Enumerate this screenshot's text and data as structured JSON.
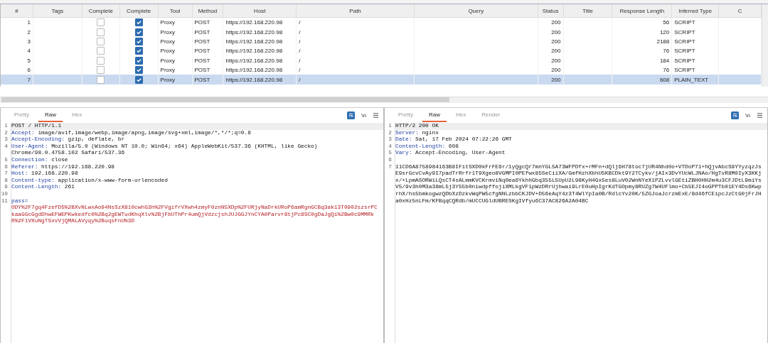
{
  "table": {
    "columns": [
      "#",
      "Tags",
      "Complete",
      "Complete",
      "Tool",
      "Method",
      "Host",
      "Path",
      "Query",
      "Status",
      "Title",
      "Response Length",
      "Inferred Type",
      "C"
    ],
    "rows": [
      {
        "num": "1",
        "complete_1": false,
        "complete_2": true,
        "tool": "Proxy",
        "method": "POST",
        "host": "https://192.168.220.98",
        "path": "/",
        "status": "200",
        "length": "56",
        "type": "SCRIPT",
        "selected": false
      },
      {
        "num": "2",
        "complete_1": false,
        "complete_2": true,
        "tool": "Proxy",
        "method": "POST",
        "host": "https://192.168.220.98",
        "path": "/",
        "status": "200",
        "length": "120",
        "type": "SCRIPT",
        "selected": false
      },
      {
        "num": "3",
        "complete_1": false,
        "complete_2": true,
        "tool": "Proxy",
        "method": "POST",
        "host": "https://192.168.220.98",
        "path": "/",
        "status": "200",
        "length": "2188",
        "type": "SCRIPT",
        "selected": false
      },
      {
        "num": "4",
        "complete_1": false,
        "complete_2": true,
        "tool": "Proxy",
        "method": "POST",
        "host": "https://192.168.220.98",
        "path": "/",
        "status": "200",
        "length": "76",
        "type": "SCRIPT",
        "selected": false
      },
      {
        "num": "5",
        "complete_1": false,
        "complete_2": true,
        "tool": "Proxy",
        "method": "POST",
        "host": "https://192.168.220.98",
        "path": "/",
        "status": "200",
        "length": "184",
        "type": "SCRIPT",
        "selected": false
      },
      {
        "num": "6",
        "complete_1": false,
        "complete_2": true,
        "tool": "Proxy",
        "method": "POST",
        "host": "https://192.168.220.98",
        "path": "/",
        "status": "200",
        "length": "76",
        "type": "SCRIPT",
        "selected": false
      },
      {
        "num": "7",
        "complete_1": false,
        "complete_2": true,
        "tool": "Proxy",
        "method": "POST",
        "host": "https://192.168.220.98",
        "path": "/",
        "status": "200",
        "length": "608",
        "type": "PLAIN_TEXT",
        "selected": true
      }
    ]
  },
  "panes": [
    {
      "tabs": [
        {
          "label": "Pretty",
          "selected": false
        },
        {
          "label": "Raw",
          "selected": true
        },
        {
          "label": "Hex",
          "selected": false
        }
      ],
      "newline_toggle": "\\n",
      "lines": [
        {
          "num": "1",
          "kind": "start",
          "text": "POST / HTTP/1.1"
        },
        {
          "num": "2",
          "kind": "header",
          "key": "Accept:",
          "text": "image/avif,image/webp,image/apng,image/svg+xml,image/*,*/*;q=0.8"
        },
        {
          "num": "3",
          "kind": "header",
          "key": "Accept-Encoding:",
          "text": "gzip, deflate, br"
        },
        {
          "num": "4",
          "kind": "header",
          "key": "User-Agent:",
          "text": "Mozilla/5.0 (Windows NT 10.0; Win64; x64) AppleWebKit/537.36 (KHTML, like Gecko) Chrome/98.0.4758.102 Safari/537.36"
        },
        {
          "num": "5",
          "kind": "header",
          "key": "Connection:",
          "text": "close"
        },
        {
          "num": "6",
          "kind": "header",
          "key": "Referer:",
          "text": "https://192.168.220.98"
        },
        {
          "num": "7",
          "kind": "header",
          "key": "Host:",
          "text": "192.168.220.98"
        },
        {
          "num": "8",
          "kind": "header",
          "key": "Content-type:",
          "text": "application/x-www-form-urlencoded"
        },
        {
          "num": "9",
          "kind": "header",
          "key": "Content-Length:",
          "text": "261"
        },
        {
          "num": "10",
          "kind": "blank"
        },
        {
          "num": "11",
          "kind": "param",
          "key": "pass=",
          "text": "ODY%2F7gq4FzefD5%2BXvNLwxAo94NsSzX810cwhG3h%2FVgifrVXwh4zmyF0znN5XDp%2FURjyNaDrkURoP6amRgnGCBq3ak13T0902szsrPCkaaGGcGgdDhwEFWEPKwkedfc0%2Bq2gEWTudKhqXlv%2BjFbUThPr4umQjVdzcjshJUJGGJYnCYA0Parvr8tjPc8SC0gDaJgQi%2Bw0c9MMRkR%2F1VXuNgTSxvVjQMALAVyqy%2BuqsFnU%3D"
        }
      ]
    },
    {
      "tabs": [
        {
          "label": "Pretty",
          "selected": false
        },
        {
          "label": "Raw",
          "selected": true
        },
        {
          "label": "Hex",
          "selected": false
        },
        {
          "label": "Render",
          "selected": false
        }
      ],
      "newline_toggle": "\\n",
      "lines": [
        {
          "num": "1",
          "kind": "start",
          "text": "HTTP/2 200 OK"
        },
        {
          "num": "2",
          "kind": "header",
          "key": "Server:",
          "text": "nginx"
        },
        {
          "num": "3",
          "kind": "header",
          "key": "Date:",
          "text": "Sat, 17 Feb 2024 07:22:26 GMT"
        },
        {
          "num": "4",
          "kind": "header",
          "key": "Content-Length:",
          "text": "608"
        },
        {
          "num": "5",
          "kind": "header",
          "key": "Vary:",
          "text": "Accept-Encoding, User-Agent"
        },
        {
          "num": "6",
          "kind": "blank"
        },
        {
          "num": "7",
          "kind": "body",
          "text": "11CD6A8758984163B8IFitSXD0kFrFE6r/1yQgcQr7mnYGL5A73WFPDfx+rMFn+dQlj6H78toc7jUR4Nhd0o+VTDoP71+hQjvAbcS9YYyzqzJsE9srGcvCvAy9I7padTrRrfr1T9Xgeo8VGMPI0PEfwx85SeCiiXA/GmfHzhXbhU5KBCDkt9Y2TCykv/jAIx3DvYUcWLJNAo/HgTvR8M0IyX3KKjx/+LpmASORWiLQsCT4sALmmKVCKrmviNq0ea6YkhhGbq355L5UpU2L98KyH4Gx5es8LuV02WnNYeX1PZLvvlGEtiZBH0HH2m4u3CFJDtL9miYsV5/9v3h0M3a38mL5j3Y55b0niwdpffojiXMLkgVF1pWzDRrUjhwai9LrE0uHpIgrKdTGOpmy8RUZg7W4UFlmo+Cb5EJI4oGPPTb01EY4Ds6KwprhX/hs5bmkogwzQDbXzDzkvWqPW5cfgNNLzbbCKJDV+D56eAqY4z3T4WlYpIa0B/RdlcYv20K/5ZGJoaJcrzmExE/8d46fCEipcJzCtG0jFrJHa0xHz5nLFm/KFBqqCQRdb/mUCCUGldUBRESKgIVfyu6C37AC826A2A04BC"
        }
      ]
    }
  ]
}
